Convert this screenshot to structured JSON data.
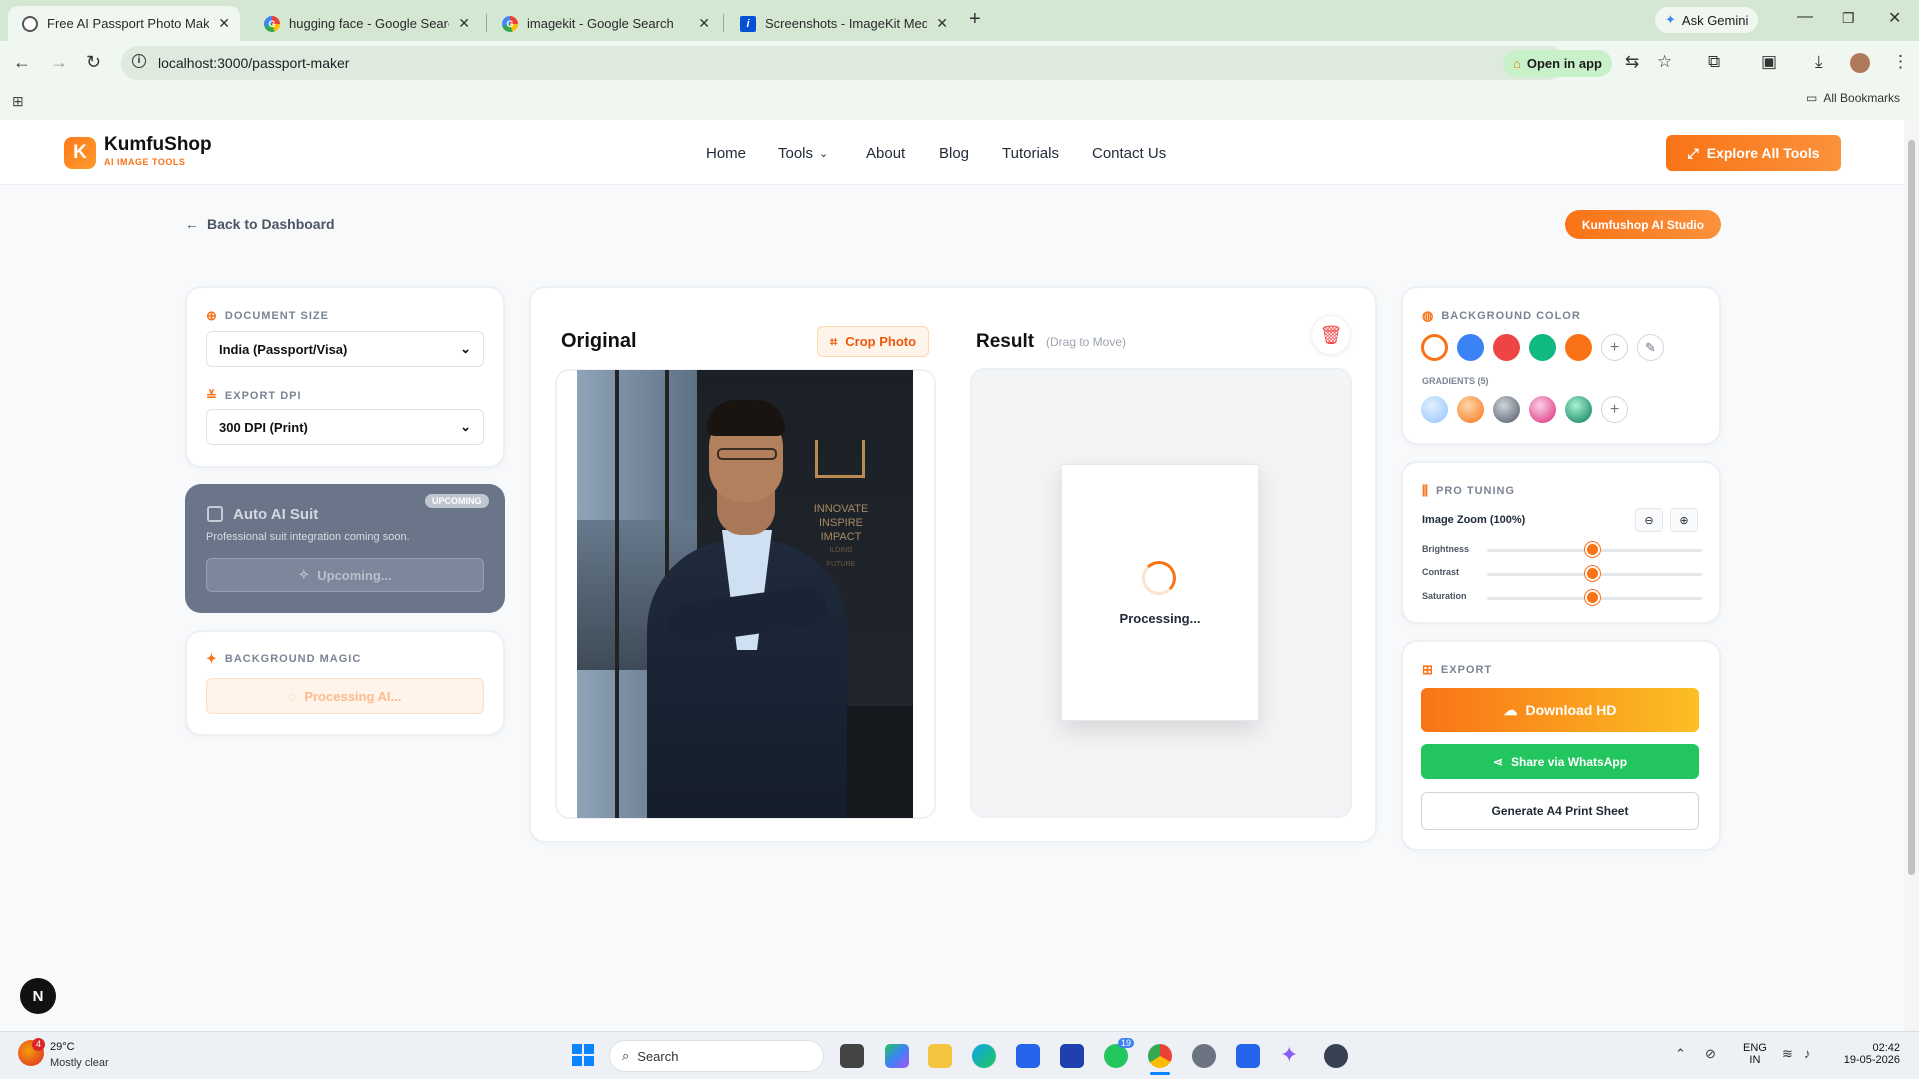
{
  "browser": {
    "tabs": [
      {
        "title": "Free AI Passport Photo Maker &",
        "active": true
      },
      {
        "title": "hugging face - Google Search"
      },
      {
        "title": "imagekit - Google Search"
      },
      {
        "title": "Screenshots - ImageKit Media L"
      }
    ],
    "ask_gemini": "Ask Gemini",
    "url": "localhost:3000/passport-maker",
    "open_in_app": "Open in app",
    "all_bookmarks": "All Bookmarks"
  },
  "header": {
    "brand": "KumfuShop",
    "brand_sub": "AI IMAGE TOOLS",
    "logo_letter": "K",
    "nav": [
      "Home",
      "Tools",
      "About",
      "Blog",
      "Tutorials",
      "Contact Us"
    ],
    "cta": "Explore All Tools"
  },
  "page": {
    "back": "Back to Dashboard",
    "studio_badge": "Kumfushop AI Studio"
  },
  "left": {
    "doc_size_label": "DOCUMENT SIZE",
    "doc_size_value": "India (Passport/Visa)",
    "export_dpi_label": "EXPORT DPI",
    "export_dpi_value": "300 DPI (Print)",
    "suit_title": "Auto AI Suit",
    "suit_badge": "UPCOMING",
    "suit_desc": "Professional suit integration coming soon.",
    "suit_button": "Upcoming...",
    "bg_magic_label": "BACKGROUND MAGIC",
    "bg_magic_button": "Processing AI..."
  },
  "center": {
    "original_title": "Original",
    "crop_button": "Crop Photo",
    "result_title": "Result",
    "result_hint": "(Drag to Move)",
    "processing": "Processing...",
    "photo_sign": [
      "INNOVATE",
      "INSPIRE",
      "IMPACT",
      "ILDING",
      "FUTURE"
    ]
  },
  "right": {
    "bg_color_label": "BACKGROUND COLOR",
    "gradients_label": "GRADIENTS (5)",
    "colors": [
      "#ffffff",
      "#3b82f6",
      "#ef4444",
      "#10b981",
      "#f97316"
    ],
    "gradients": [
      "#bfdbfe",
      "#fb923c",
      "#6b7280",
      "#ec4899",
      "#10b981"
    ],
    "pro_tuning_label": "PRO TUNING",
    "zoom_label": "Image Zoom (100%)",
    "sliders": [
      {
        "label": "Brightness",
        "value": 0.49
      },
      {
        "label": "Contrast",
        "value": 0.49
      },
      {
        "label": "Saturation",
        "value": 0.49
      }
    ],
    "export_label": "EXPORT",
    "download": "Download HD",
    "whatsapp": "Share via WhatsApp",
    "a4": "Generate A4 Print Sheet"
  },
  "taskbar": {
    "temp": "29°C",
    "weather": "Mostly clear",
    "weather_badge": "4",
    "search": "Search",
    "whatsapp_badge": "19",
    "lang1": "ENG",
    "lang2": "IN",
    "time": "02:42",
    "date": "19-05-2026"
  },
  "n_avatar": "N"
}
